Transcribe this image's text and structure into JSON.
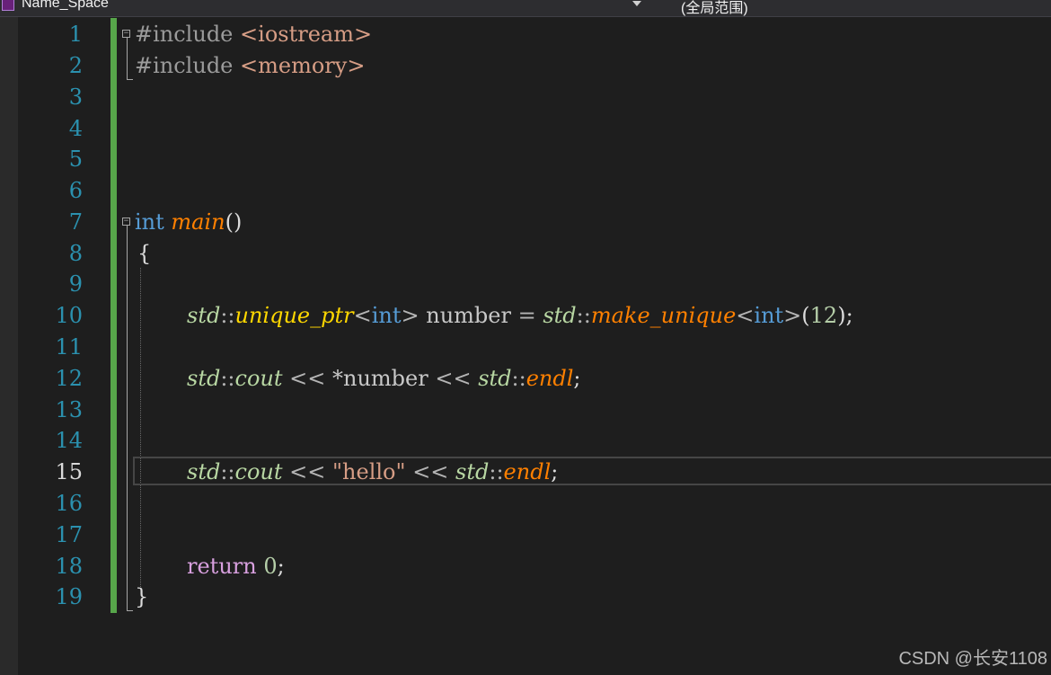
{
  "navbar": {
    "scope_dropdown": "Name_Space",
    "member_dropdown": "(全局范围)"
  },
  "editor": {
    "current_line": 15,
    "line_numbers": [
      "1",
      "2",
      "3",
      "4",
      "5",
      "6",
      "7",
      "8",
      "9",
      "10",
      "11",
      "12",
      "13",
      "14",
      "15",
      "16",
      "17",
      "18",
      "19"
    ],
    "lines": {
      "l1": {
        "directive": "#include",
        "header": "<iostream>"
      },
      "l2": {
        "directive": "#include",
        "header": "<memory>"
      },
      "l7": {
        "type": "int",
        "func": "main",
        "parens": "()"
      },
      "l8": {
        "brace": "{"
      },
      "l10": {
        "ns1": "std",
        "sep1": "::",
        "cls": "unique_ptr",
        "lt1": "<",
        "targ1": "int",
        "gt1": ">",
        "var": "number",
        "eq": "=",
        "ns2": "std",
        "sep2": "::",
        "func": "make_unique",
        "lt2": "<",
        "targ2": "int",
        "gt2": ">",
        "lp": "(",
        "num": "12",
        "rp": ")",
        "semi": ";"
      },
      "l12": {
        "ns1": "std",
        "sep1": "::",
        "cout": "cout",
        "op1": "<<",
        "deref": "*number",
        "op2": "<<",
        "ns2": "std",
        "sep2": "::",
        "endl": "endl",
        "semi": ";"
      },
      "l15": {
        "ns1": "std",
        "sep1": "::",
        "cout": "cout",
        "op1": "<<",
        "str": "\"hello\"",
        "op2": "<<",
        "ns2": "std",
        "sep2": "::",
        "endl": "endl",
        "semi": ";"
      },
      "l18": {
        "kw": "return",
        "num": "0",
        "semi": ";"
      },
      "l19": {
        "brace": "}"
      }
    }
  },
  "watermark": "CSDN @长安1108",
  "colors": {
    "background": "#1e1e1e",
    "line_number": "#2b91af",
    "change_bar": "#57a64a",
    "preprocessor": "#9b9b9b",
    "include_path": "#d69d85",
    "keyword": "#569cd6",
    "control_keyword": "#d8a0df",
    "function": "#ff8000",
    "namespace": "#b8d7a3",
    "class": "#ffd700",
    "number": "#b5cea8",
    "string": "#d69d85"
  }
}
